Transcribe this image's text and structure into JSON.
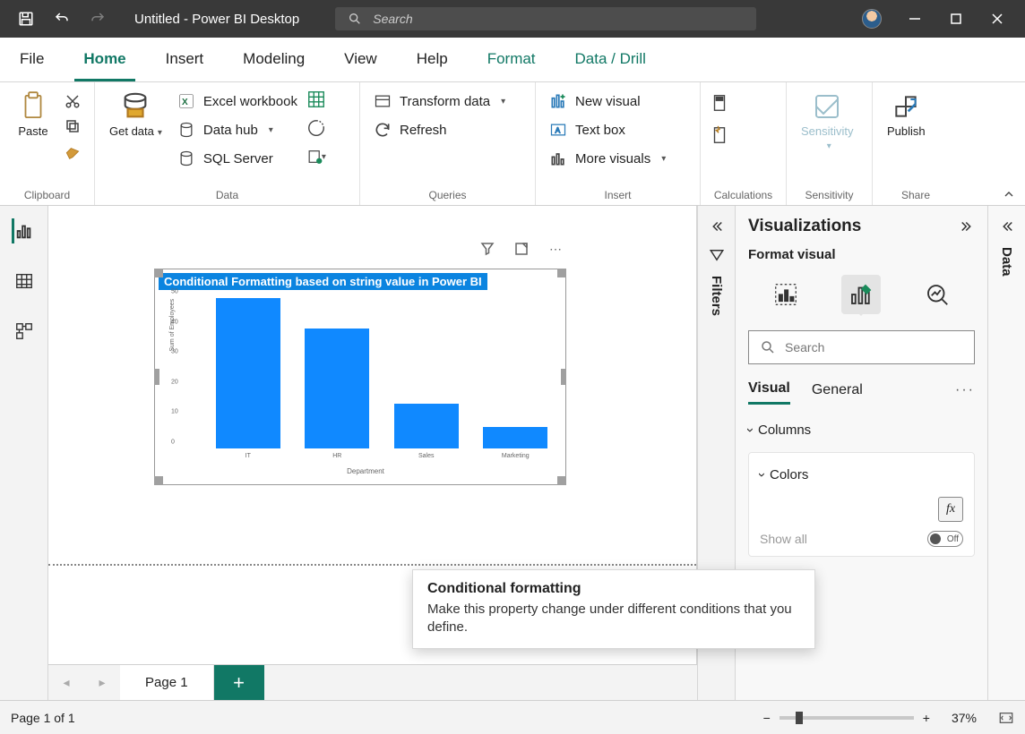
{
  "titlebar": {
    "title": "Untitled - Power BI Desktop",
    "search_placeholder": "Search"
  },
  "tabs": [
    "File",
    "Home",
    "Insert",
    "Modeling",
    "View",
    "Help",
    "Format",
    "Data / Drill"
  ],
  "active_tab": "Home",
  "ribbon": {
    "clipboard": {
      "label": "Clipboard",
      "paste": "Paste"
    },
    "data": {
      "label": "Data",
      "get": "Get\ndata",
      "excel": "Excel workbook",
      "hub": "Data hub",
      "sql": "SQL Server"
    },
    "queries": {
      "label": "Queries",
      "transform": "Transform data",
      "refresh": "Refresh"
    },
    "insert": {
      "label": "Insert",
      "newvis": "New visual",
      "textbox": "Text box",
      "more": "More visuals"
    },
    "calc": {
      "label": "Calculations"
    },
    "sens": {
      "label": "Sensitivity",
      "btn": "Sensitivity"
    },
    "share": {
      "label": "Share",
      "publish": "Publish"
    }
  },
  "filters_label": "Filters",
  "vis": {
    "title": "Visualizations",
    "subtitle": "Format visual",
    "search_placeholder": "Search",
    "tabs": {
      "visual": "Visual",
      "general": "General"
    },
    "columns": "Columns",
    "colors": "Colors",
    "showall": "Show all",
    "off": "Off"
  },
  "data_label": "Data",
  "page": {
    "tab": "Page 1",
    "status": "Page 1 of 1",
    "zoom": "37%"
  },
  "tooltip": {
    "title": "Conditional formatting",
    "body": "Make this property change under different conditions that you define."
  },
  "chart_data": {
    "type": "bar",
    "title": "Conditional Formatting based on string value in Power BI",
    "xlabel": "Department",
    "ylabel": "Sum of Employees",
    "categories": [
      "IT",
      "HR",
      "Sales",
      "Marketing"
    ],
    "values": [
      50,
      40,
      15,
      7
    ],
    "ylim": [
      0,
      50
    ],
    "yticks": [
      0,
      10,
      20,
      30,
      40,
      50
    ],
    "color": "#1089FF"
  }
}
